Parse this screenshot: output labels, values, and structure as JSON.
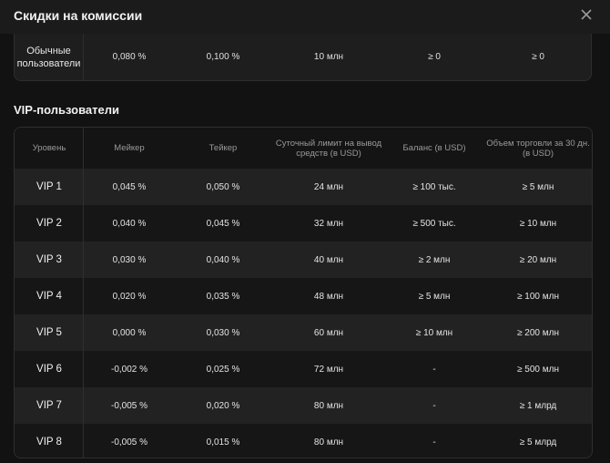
{
  "header": {
    "title": "Скидки на комиссии",
    "close_icon": "close-icon"
  },
  "standard": {
    "label": "Обычные пользователи",
    "maker": "0,080 %",
    "taker": "0,100 %",
    "withdraw_limit": "10 млн",
    "balance": "≥ 0",
    "volume": "≥ 0"
  },
  "vip": {
    "title": "VIP-пользователи",
    "columns": [
      "Уровень",
      "Мейкер",
      "Тейкер",
      "Суточный лимит на вывод средств (в USD)",
      "Баланс (в USD)",
      "Объем торговли за 30 дн. (в USD)"
    ],
    "rows": [
      {
        "level": "VIP 1",
        "maker": "0,045 %",
        "taker": "0,050 %",
        "limit": "24 млн",
        "balance": "≥ 100 тыс.",
        "volume": "≥ 5 млн"
      },
      {
        "level": "VIP 2",
        "maker": "0,040 %",
        "taker": "0,045 %",
        "limit": "32 млн",
        "balance": "≥ 500 тыс.",
        "volume": "≥ 10 млн"
      },
      {
        "level": "VIP 3",
        "maker": "0,030 %",
        "taker": "0,040 %",
        "limit": "40 млн",
        "balance": "≥ 2 млн",
        "volume": "≥ 20 млн"
      },
      {
        "level": "VIP 4",
        "maker": "0,020 %",
        "taker": "0,035 %",
        "limit": "48 млн",
        "balance": "≥ 5 млн",
        "volume": "≥ 100 млн"
      },
      {
        "level": "VIP 5",
        "maker": "0,000 %",
        "taker": "0,030 %",
        "limit": "60 млн",
        "balance": "≥ 10 млн",
        "volume": "≥ 200 млн"
      },
      {
        "level": "VIP 6",
        "maker": "-0,002 %",
        "taker": "0,025 %",
        "limit": "72 млн",
        "balance": "-",
        "volume": "≥ 500 млн"
      },
      {
        "level": "VIP 7",
        "maker": "-0,005 %",
        "taker": "0,020 %",
        "limit": "80 млн",
        "balance": "-",
        "volume": "≥ 1 млрд"
      },
      {
        "level": "VIP 8",
        "maker": "-0,005 %",
        "taker": "0,015 %",
        "limit": "80 млн",
        "balance": "-",
        "volume": "≥ 5 млрд"
      }
    ]
  }
}
